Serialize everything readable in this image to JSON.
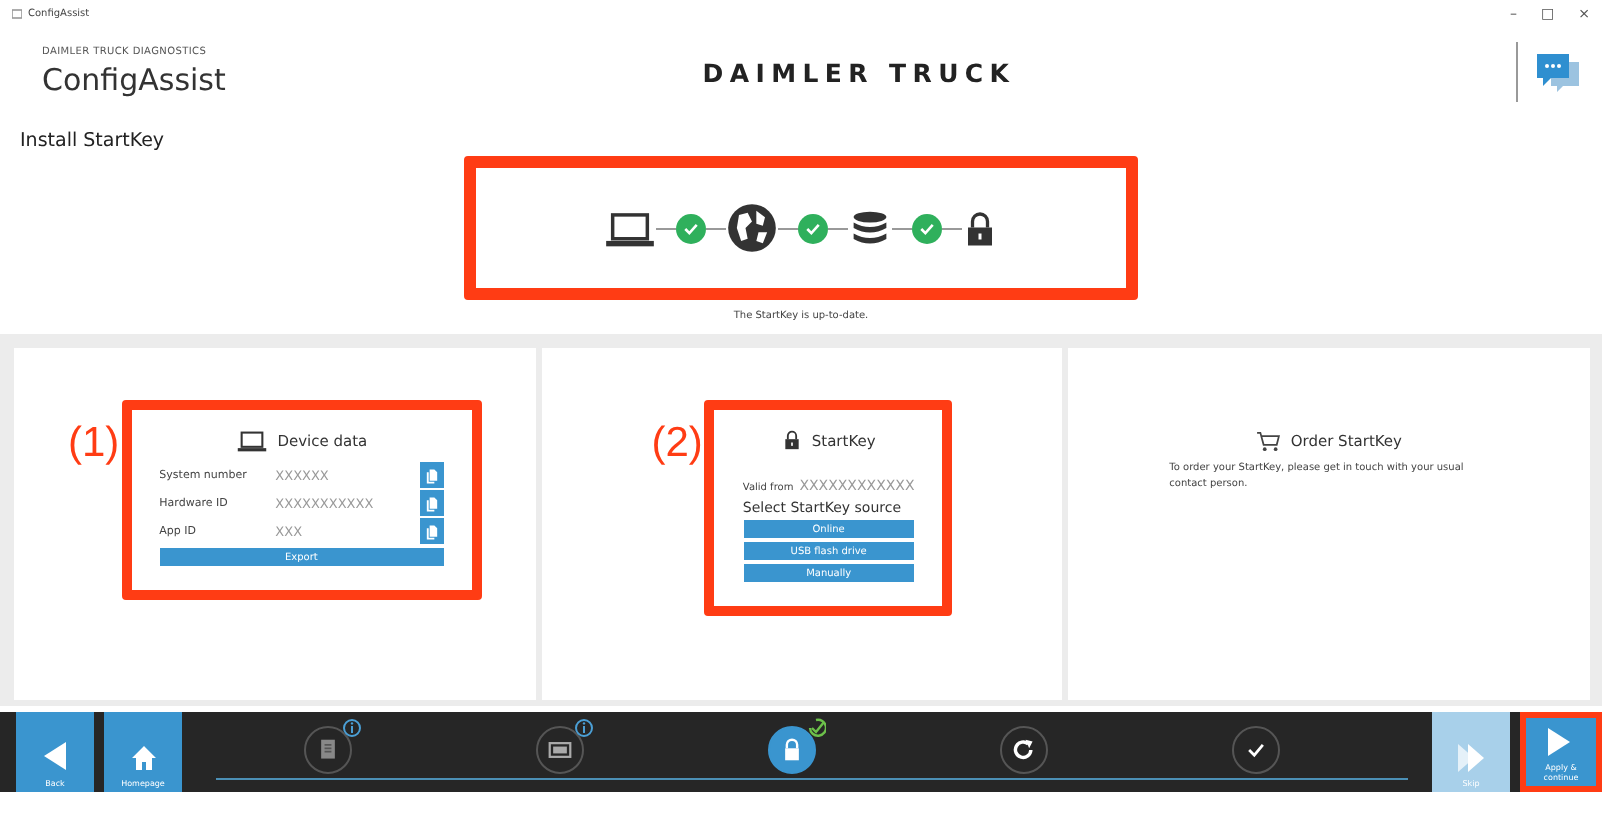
{
  "window": {
    "title": "ConfigAssist",
    "controls": [
      "–",
      "□",
      "×"
    ]
  },
  "header": {
    "brand_line": "DAIMLER TRUCK DIAGNOSTICS",
    "app_name": "ConfigAssist",
    "company": "DAIMLER TRUCK"
  },
  "page_title": "Install StartKey",
  "progress": {
    "highlighted": true,
    "connectors": [
      {
        "done": true
      },
      {
        "done": true
      },
      {
        "done": true
      }
    ],
    "status": "The StartKey is up-to-date."
  },
  "cards": [
    {
      "kind": "device",
      "title": "Device data",
      "callout": "(1)",
      "highlighted": true,
      "rows": [
        {
          "label": "System number",
          "value": "XXXXXX"
        },
        {
          "label": "Hardware ID",
          "value": "XXXXXXXXXXX"
        },
        {
          "label": "App ID",
          "value": "XXX"
        }
      ],
      "button": "Export"
    },
    {
      "kind": "startkey",
      "title": "StartKey",
      "callout": "(2)",
      "highlighted": true,
      "valid_label": "Valid from",
      "valid_value": "XXXXXXXXXXXX",
      "prompt": "Select StartKey source",
      "buttons": [
        "Online",
        "USB flash drive",
        "Manually"
      ]
    },
    {
      "kind": "order",
      "title": "Order StartKey",
      "text": "To order your StartKey, please get in touch with your usual contact person."
    }
  ],
  "bottom_bar": {
    "left_buttons": [
      {
        "kind": "back",
        "label": "Back"
      },
      {
        "kind": "home",
        "label": "Homepage"
      }
    ],
    "steps": [
      {
        "kind": "document",
        "selected": false,
        "attention": true,
        "completed": false
      },
      {
        "kind": "tablet",
        "selected": false,
        "attention": true,
        "completed": false
      },
      {
        "kind": "lock",
        "selected": true,
        "attention": false,
        "completed": true
      },
      {
        "kind": "refresh",
        "selected": false,
        "attention": false,
        "completed": false
      },
      {
        "kind": "check",
        "selected": false,
        "attention": false,
        "completed": false
      }
    ],
    "right_buttons": [
      {
        "kind": "skip",
        "label": "Skip",
        "disabled": true,
        "highlighted": false
      },
      {
        "kind": "apply",
        "label": "Apply & continue",
        "disabled": false,
        "highlighted": true
      }
    ]
  }
}
